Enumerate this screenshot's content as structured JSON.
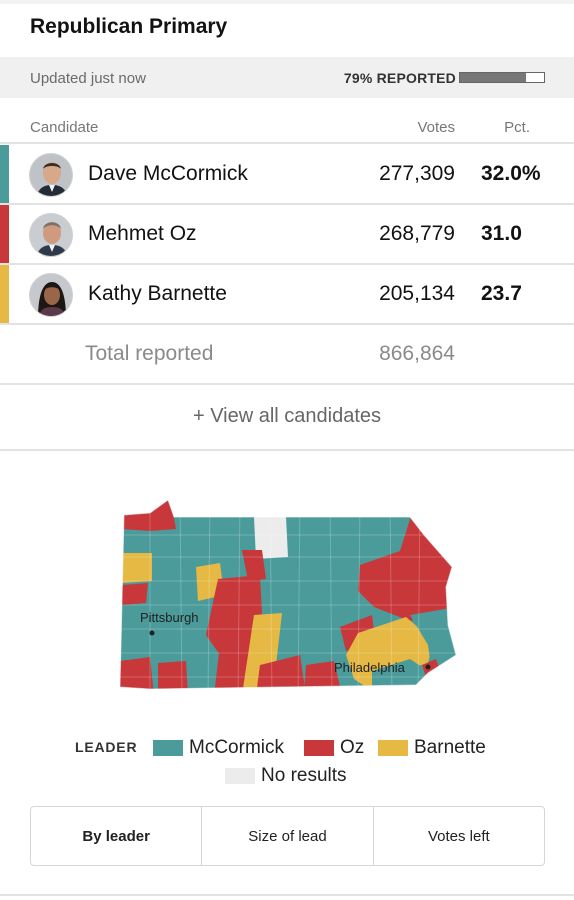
{
  "title": "Republican Primary",
  "status": {
    "updated": "Updated just now",
    "reported": "79% REPORTED",
    "reported_fraction": 0.79
  },
  "table": {
    "headers": {
      "candidate": "Candidate",
      "votes": "Votes",
      "pct": "Pct."
    },
    "rows": [
      {
        "name": "Dave McCormick",
        "votes": "277,309",
        "pct": "32.0%",
        "color": "#4b9b9b"
      },
      {
        "name": "Mehmet Oz",
        "votes": "268,779",
        "pct": "31.0",
        "color": "#c8373a"
      },
      {
        "name": "Kathy Barnette",
        "votes": "205,134",
        "pct": "23.7",
        "color": "#e6b944"
      }
    ],
    "total": {
      "label": "Total reported",
      "votes": "866,864"
    }
  },
  "view_all": "+ View all candidates",
  "map": {
    "labels": {
      "pittsburgh": "Pittsburgh",
      "philadelphia": "Philadelphia"
    },
    "colors": {
      "mccormick": "#4b9b9b",
      "oz": "#c8373a",
      "barnette": "#e6b944",
      "no_results": "#ececec"
    }
  },
  "legend": {
    "title": "LEADER",
    "items": [
      {
        "label": "McCormick",
        "color": "#4b9b9b"
      },
      {
        "label": "Oz",
        "color": "#c8373a"
      },
      {
        "label": "Barnette",
        "color": "#e6b944"
      },
      {
        "label": "No results",
        "color": "#ececec"
      }
    ]
  },
  "tabs": [
    {
      "label": "By leader",
      "active": true
    },
    {
      "label": "Size of lead",
      "active": false
    },
    {
      "label": "Votes left",
      "active": false
    }
  ]
}
